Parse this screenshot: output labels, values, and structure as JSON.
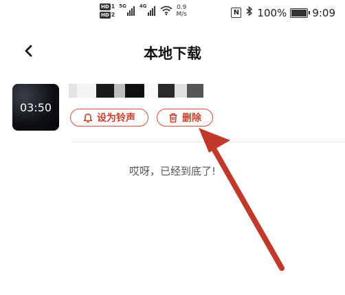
{
  "status_bar": {
    "hd1": "HD",
    "hd1_num": "1",
    "hd2": "HD",
    "hd2_num": "2",
    "sig1_label": "5G",
    "sig2_label": "4G",
    "speed_value": "0.9",
    "speed_unit": "M/s",
    "nfc": "N",
    "battery": "100%",
    "battery_level": 1.0,
    "time": "9:09"
  },
  "header": {
    "title": "本地下载",
    "back_icon": "chevron-left-icon"
  },
  "item": {
    "duration": "03:50",
    "set_ringtone_label": "设为铃声",
    "delete_label": "删除",
    "ringtone_icon": "bell-icon",
    "delete_icon": "trash-icon"
  },
  "list_end_text": "哎呀，已经到底了!",
  "colors": {
    "accent": "#c9402f",
    "arrow": "#c0392b"
  }
}
